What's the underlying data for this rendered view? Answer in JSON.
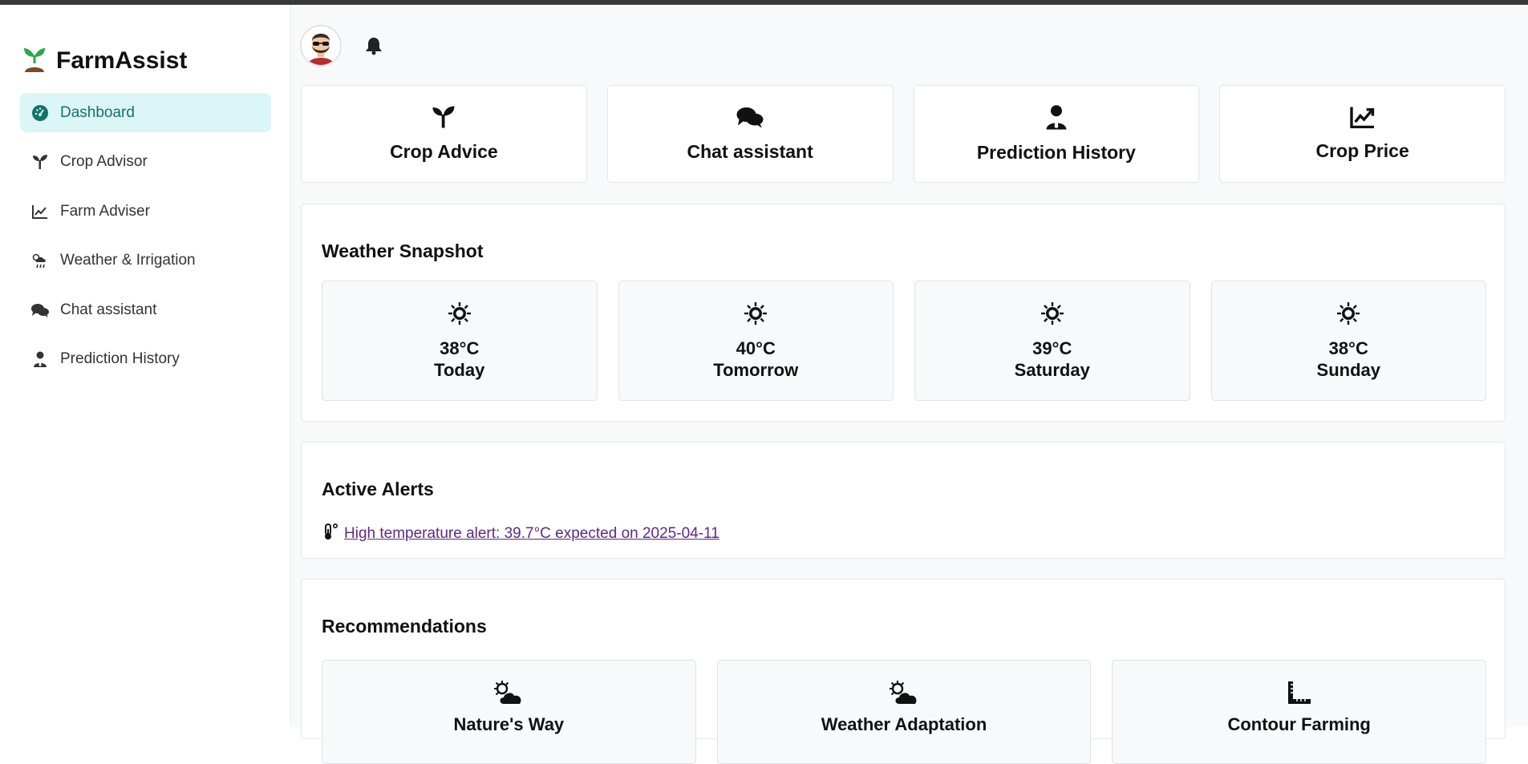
{
  "app": {
    "title": "FarmAssist"
  },
  "sidebar": {
    "items": [
      {
        "label": "Dashboard",
        "icon": "gauge-icon",
        "active": true
      },
      {
        "label": "Crop Advisor",
        "icon": "seedling-icon"
      },
      {
        "label": "Farm Adviser",
        "icon": "chart-line-icon"
      },
      {
        "label": "Weather & Irrigation",
        "icon": "cloud-sun-rain-icon"
      },
      {
        "label": "Chat assistant",
        "icon": "comments-icon"
      },
      {
        "label": "Prediction History",
        "icon": "user-tie-icon"
      }
    ]
  },
  "quick": [
    {
      "label": "Crop Advice",
      "icon": "seedling-icon"
    },
    {
      "label": "Chat assistant",
      "icon": "comments-icon"
    },
    {
      "label": "Prediction History",
      "icon": "user-tie-icon"
    },
    {
      "label": "Crop Price",
      "icon": "chart-line-icon"
    }
  ],
  "weather": {
    "title": "Weather Snapshot",
    "days": [
      {
        "temp": "38°C",
        "day": "Today"
      },
      {
        "temp": "40°C",
        "day": "Tomorrow"
      },
      {
        "temp": "39°C",
        "day": "Saturday"
      },
      {
        "temp": "38°C",
        "day": "Sunday"
      }
    ]
  },
  "alerts": {
    "title": "Active Alerts",
    "items": [
      {
        "text": "High temperature alert: 39.7°C expected on 2025-04-11",
        "icon": "thermometer-icon"
      }
    ]
  },
  "recommendations": {
    "title": "Recommendations",
    "items": [
      {
        "label": "Nature's Way",
        "icon": "cloud-sun-icon"
      },
      {
        "label": "Weather Adaptation",
        "icon": "cloud-sun-icon"
      },
      {
        "label": "Contour Farming",
        "icon": "ruler-combined-icon"
      }
    ]
  },
  "colors": {
    "accent": "#13736b",
    "active_bg": "#dcf5f7",
    "brand_green": "#2aa84a",
    "link": "#5a2a82"
  }
}
